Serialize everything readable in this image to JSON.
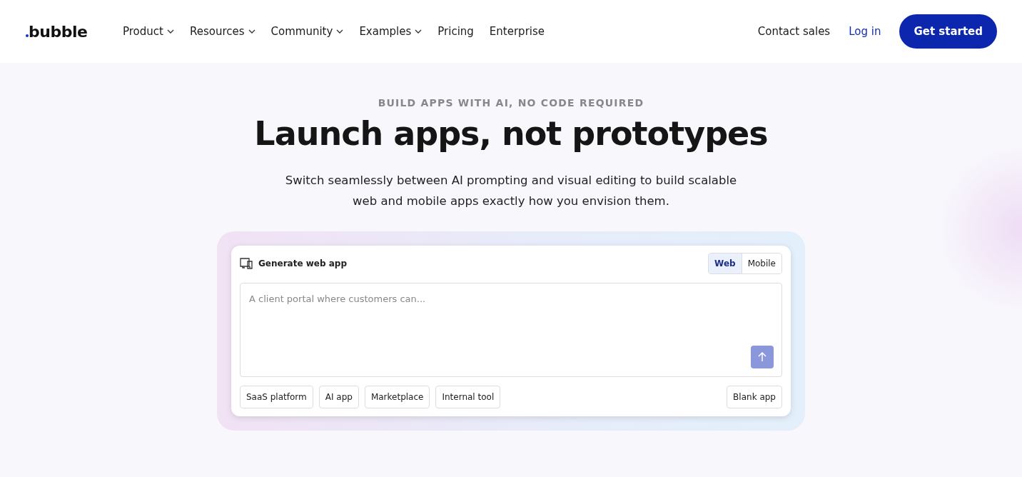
{
  "header": {
    "logo": "bubble",
    "nav": [
      {
        "label": "Product",
        "has_menu": true
      },
      {
        "label": "Resources",
        "has_menu": true
      },
      {
        "label": "Community",
        "has_menu": true
      },
      {
        "label": "Examples",
        "has_menu": true
      },
      {
        "label": "Pricing",
        "has_menu": false
      },
      {
        "label": "Enterprise",
        "has_menu": false
      }
    ],
    "contact": "Contact sales",
    "login": "Log in",
    "cta": "Get started"
  },
  "hero": {
    "eyebrow": "BUILD APPS WITH AI, NO CODE REQUIRED",
    "title": "Launch apps, not prototypes",
    "subtitle": "Switch seamlessly between AI prompting and visual editing to build scalable web and mobile apps exactly how you envision them."
  },
  "generator": {
    "label": "Generate web app",
    "platforms": [
      {
        "label": "Web",
        "selected": true
      },
      {
        "label": "Mobile",
        "selected": false
      }
    ],
    "prompt": {
      "placeholder": "A client portal where customers can..."
    },
    "submit_disabled": true,
    "templates": [
      "SaaS platform",
      "AI app",
      "Marketplace",
      "Internal tool"
    ],
    "blank": "Blank app"
  }
}
